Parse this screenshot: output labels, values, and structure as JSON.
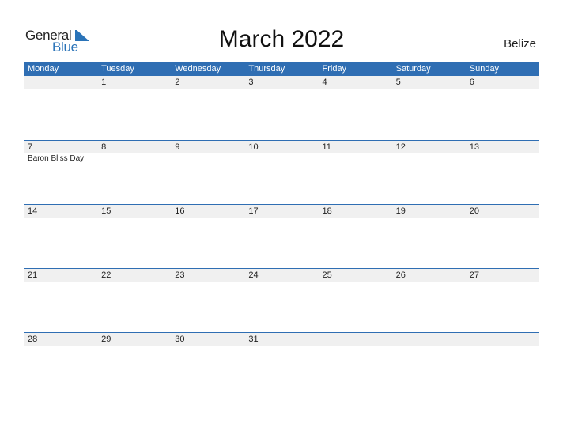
{
  "logo": {
    "word1": "General",
    "word2": "Blue",
    "icon": "triangle-flag-icon",
    "accent": "#2a73b8"
  },
  "title": "March 2022",
  "country": "Belize",
  "colors": {
    "header_bg": "#2f6eb3",
    "date_strip_bg": "#f0f0f0"
  },
  "weekdays": [
    "Monday",
    "Tuesday",
    "Wednesday",
    "Thursday",
    "Friday",
    "Saturday",
    "Sunday"
  ],
  "weeks": [
    {
      "days": [
        "",
        "1",
        "2",
        "3",
        "4",
        "5",
        "6"
      ],
      "events": [
        "",
        "",
        "",
        "",
        "",
        "",
        ""
      ]
    },
    {
      "days": [
        "7",
        "8",
        "9",
        "10",
        "11",
        "12",
        "13"
      ],
      "events": [
        "Baron Bliss Day",
        "",
        "",
        "",
        "",
        "",
        ""
      ]
    },
    {
      "days": [
        "14",
        "15",
        "16",
        "17",
        "18",
        "19",
        "20"
      ],
      "events": [
        "",
        "",
        "",
        "",
        "",
        "",
        ""
      ]
    },
    {
      "days": [
        "21",
        "22",
        "23",
        "24",
        "25",
        "26",
        "27"
      ],
      "events": [
        "",
        "",
        "",
        "",
        "",
        "",
        ""
      ]
    },
    {
      "days": [
        "28",
        "29",
        "30",
        "31",
        "",
        "",
        ""
      ],
      "events": [
        "",
        "",
        "",
        "",
        "",
        "",
        ""
      ]
    }
  ]
}
